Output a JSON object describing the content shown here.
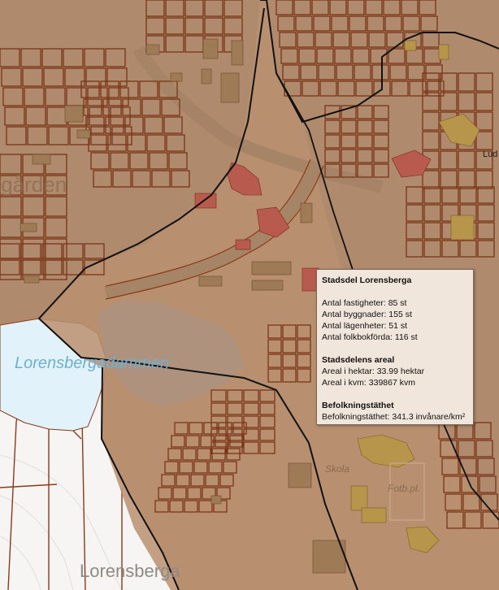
{
  "labels": {
    "district_top_left": "tgården",
    "lake": "Lorensbergadammen",
    "area_bottom": "Lorensberga",
    "school": "Skola",
    "football": "Fotb.pl.",
    "street_edge": "Lud"
  },
  "popup": {
    "title": "Stadsdel Lorensberga",
    "stats": [
      "Antal fastigheter: 85 st",
      "Antal byggnader: 155 st",
      "Antal lägenheter: 51 st",
      "Antal folkbokförda: 116 st"
    ],
    "area_heading": "Stadsdelens areal",
    "area": [
      "Areal i hektar: 33.99 hektar",
      "Areal i kvm: 339867 kvm"
    ],
    "density_heading": "Befolkningstäthet",
    "density": "Befolkningstäthet: 341.3 invånare/km²"
  },
  "colors": {
    "base": "#b08a6c",
    "district_fill": "#ba9070",
    "parcel_line": "#7a3518",
    "district_border": "#111111",
    "lake": "#e2f2fa",
    "lake_label": "#6fb0d0",
    "building": "#9e7a56",
    "highlight_building": "#b85a4e",
    "school_building": "#b7954a",
    "popup_bg": "#f1e6dc"
  }
}
